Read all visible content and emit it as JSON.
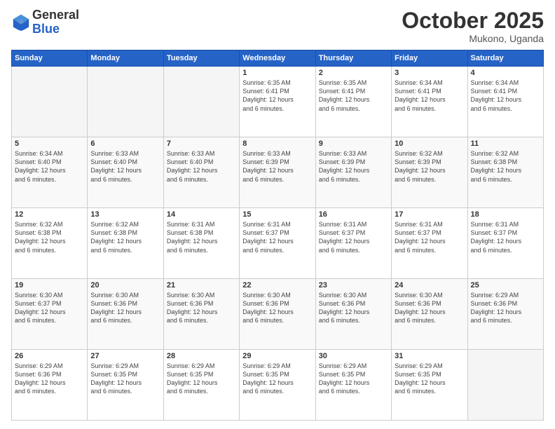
{
  "logo": {
    "general": "General",
    "blue": "Blue"
  },
  "header": {
    "month": "October 2025",
    "location": "Mukono, Uganda"
  },
  "weekdays": [
    "Sunday",
    "Monday",
    "Tuesday",
    "Wednesday",
    "Thursday",
    "Friday",
    "Saturday"
  ],
  "weeks": [
    [
      {
        "day": "",
        "info": ""
      },
      {
        "day": "",
        "info": ""
      },
      {
        "day": "",
        "info": ""
      },
      {
        "day": "1",
        "info": "Sunrise: 6:35 AM\nSunset: 6:41 PM\nDaylight: 12 hours\nand 6 minutes."
      },
      {
        "day": "2",
        "info": "Sunrise: 6:35 AM\nSunset: 6:41 PM\nDaylight: 12 hours\nand 6 minutes."
      },
      {
        "day": "3",
        "info": "Sunrise: 6:34 AM\nSunset: 6:41 PM\nDaylight: 12 hours\nand 6 minutes."
      },
      {
        "day": "4",
        "info": "Sunrise: 6:34 AM\nSunset: 6:41 PM\nDaylight: 12 hours\nand 6 minutes."
      }
    ],
    [
      {
        "day": "5",
        "info": "Sunrise: 6:34 AM\nSunset: 6:40 PM\nDaylight: 12 hours\nand 6 minutes."
      },
      {
        "day": "6",
        "info": "Sunrise: 6:33 AM\nSunset: 6:40 PM\nDaylight: 12 hours\nand 6 minutes."
      },
      {
        "day": "7",
        "info": "Sunrise: 6:33 AM\nSunset: 6:40 PM\nDaylight: 12 hours\nand 6 minutes."
      },
      {
        "day": "8",
        "info": "Sunrise: 6:33 AM\nSunset: 6:39 PM\nDaylight: 12 hours\nand 6 minutes."
      },
      {
        "day": "9",
        "info": "Sunrise: 6:33 AM\nSunset: 6:39 PM\nDaylight: 12 hours\nand 6 minutes."
      },
      {
        "day": "10",
        "info": "Sunrise: 6:32 AM\nSunset: 6:39 PM\nDaylight: 12 hours\nand 6 minutes."
      },
      {
        "day": "11",
        "info": "Sunrise: 6:32 AM\nSunset: 6:38 PM\nDaylight: 12 hours\nand 6 minutes."
      }
    ],
    [
      {
        "day": "12",
        "info": "Sunrise: 6:32 AM\nSunset: 6:38 PM\nDaylight: 12 hours\nand 6 minutes."
      },
      {
        "day": "13",
        "info": "Sunrise: 6:32 AM\nSunset: 6:38 PM\nDaylight: 12 hours\nand 6 minutes."
      },
      {
        "day": "14",
        "info": "Sunrise: 6:31 AM\nSunset: 6:38 PM\nDaylight: 12 hours\nand 6 minutes."
      },
      {
        "day": "15",
        "info": "Sunrise: 6:31 AM\nSunset: 6:37 PM\nDaylight: 12 hours\nand 6 minutes."
      },
      {
        "day": "16",
        "info": "Sunrise: 6:31 AM\nSunset: 6:37 PM\nDaylight: 12 hours\nand 6 minutes."
      },
      {
        "day": "17",
        "info": "Sunrise: 6:31 AM\nSunset: 6:37 PM\nDaylight: 12 hours\nand 6 minutes."
      },
      {
        "day": "18",
        "info": "Sunrise: 6:31 AM\nSunset: 6:37 PM\nDaylight: 12 hours\nand 6 minutes."
      }
    ],
    [
      {
        "day": "19",
        "info": "Sunrise: 6:30 AM\nSunset: 6:37 PM\nDaylight: 12 hours\nand 6 minutes."
      },
      {
        "day": "20",
        "info": "Sunrise: 6:30 AM\nSunset: 6:36 PM\nDaylight: 12 hours\nand 6 minutes."
      },
      {
        "day": "21",
        "info": "Sunrise: 6:30 AM\nSunset: 6:36 PM\nDaylight: 12 hours\nand 6 minutes."
      },
      {
        "day": "22",
        "info": "Sunrise: 6:30 AM\nSunset: 6:36 PM\nDaylight: 12 hours\nand 6 minutes."
      },
      {
        "day": "23",
        "info": "Sunrise: 6:30 AM\nSunset: 6:36 PM\nDaylight: 12 hours\nand 6 minutes."
      },
      {
        "day": "24",
        "info": "Sunrise: 6:30 AM\nSunset: 6:36 PM\nDaylight: 12 hours\nand 6 minutes."
      },
      {
        "day": "25",
        "info": "Sunrise: 6:29 AM\nSunset: 6:36 PM\nDaylight: 12 hours\nand 6 minutes."
      }
    ],
    [
      {
        "day": "26",
        "info": "Sunrise: 6:29 AM\nSunset: 6:36 PM\nDaylight: 12 hours\nand 6 minutes."
      },
      {
        "day": "27",
        "info": "Sunrise: 6:29 AM\nSunset: 6:35 PM\nDaylight: 12 hours\nand 6 minutes."
      },
      {
        "day": "28",
        "info": "Sunrise: 6:29 AM\nSunset: 6:35 PM\nDaylight: 12 hours\nand 6 minutes."
      },
      {
        "day": "29",
        "info": "Sunrise: 6:29 AM\nSunset: 6:35 PM\nDaylight: 12 hours\nand 6 minutes."
      },
      {
        "day": "30",
        "info": "Sunrise: 6:29 AM\nSunset: 6:35 PM\nDaylight: 12 hours\nand 6 minutes."
      },
      {
        "day": "31",
        "info": "Sunrise: 6:29 AM\nSunset: 6:35 PM\nDaylight: 12 hours\nand 6 minutes."
      },
      {
        "day": "",
        "info": ""
      }
    ]
  ]
}
